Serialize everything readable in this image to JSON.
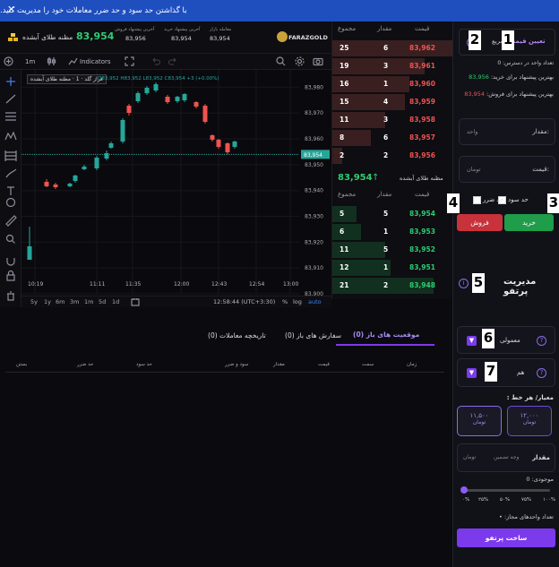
{
  "banner": {
    "text": "با گذاشتن حد سود و حد ضرر معاملات خود را مدیریت کنید.",
    "close": "✕"
  },
  "topbar": {
    "brand": "FARAZGOLD",
    "stat1_label": "معامله بازار",
    "stat1_value": "83,954",
    "stat2_label": "آخرین پیشنهاد خرید",
    "stat2_value": "83,954",
    "stat3_label": "آخرین پیشنهاد فروش",
    "stat3_value": "83,956",
    "price": "83,954",
    "instrument": "مظنه طلای آبشده"
  },
  "chart_toolbar": {
    "interval": "1m",
    "indicators": "Indicators"
  },
  "chart": {
    "legend_title": "فراز گلد · 1 · مظنه طلای آبشده",
    "ohlc": "O83,952 H83,952 L83,952 C83,954 +3 (+0.00%)",
    "price_ticks": [
      "83,980",
      "83,970",
      "83,960",
      "83,950",
      "83,940",
      "83,930",
      "83,920",
      "83,910",
      "83,900"
    ],
    "current_price": "83,954",
    "time_ticks": [
      "10:19",
      "11:11",
      "11:35",
      "12:00",
      "12:43",
      "12:54",
      "13:00"
    ],
    "ranges": [
      "5y",
      "1y",
      "6m",
      "3m",
      "1m",
      "5d",
      "1d"
    ],
    "clock": "12:58:44 (UTC+3:30)",
    "scale_opts": [
      "%",
      "log",
      "auto"
    ]
  },
  "orderbook": {
    "headers": [
      "قیمت",
      "مقدار",
      "مجموع"
    ],
    "asks": [
      {
        "price": "83,962",
        "qty": "6",
        "total": "25"
      },
      {
        "price": "83,961",
        "qty": "3",
        "total": "19"
      },
      {
        "price": "83,960",
        "qty": "1",
        "total": "16"
      },
      {
        "price": "83,959",
        "qty": "4",
        "total": "15"
      },
      {
        "price": "83,958",
        "qty": "3",
        "total": "11"
      },
      {
        "price": "83,957",
        "qty": "6",
        "total": "8"
      },
      {
        "price": "83,956",
        "qty": "2",
        "total": "2"
      }
    ],
    "mid_label": "مظنه طلای آبشده",
    "mid_price": "83,954",
    "bids": [
      {
        "price": "83,954",
        "qty": "5",
        "total": "5"
      },
      {
        "price": "83,953",
        "qty": "1",
        "total": "6"
      },
      {
        "price": "83,952",
        "qty": "5",
        "total": "11"
      },
      {
        "price": "83,951",
        "qty": "1",
        "total": "12"
      },
      {
        "price": "83,948",
        "qty": "2",
        "total": "21"
      }
    ]
  },
  "side": {
    "tab_set_price": "تعیین قیمت",
    "tab_fast": "سریع",
    "units_note": "تعداد واحد در دسترس: 0",
    "best_buy_label": "بهترین پیشنهاد برای خرید:",
    "best_buy_value": "83,956",
    "best_sell_label": "بهترین پیشنهاد برای فروش:",
    "best_sell_value": "83,954",
    "qty_label": "مقدار:",
    "qty_unit": "واحد",
    "price_label": "قیمت:",
    "price_unit": "تومان",
    "take_profit": "حد سود",
    "stop_loss": "حد ضرر",
    "buy": "خرید",
    "sell": "فروش",
    "portfolio_title": "مدیریت پرتفو",
    "mode_label": "معمولی",
    "hedge_label": "هم",
    "criteria_label": "معیار/ هر خط :",
    "opt1_value": "۱۲,۰۰۰",
    "opt1_unit": "تومان",
    "opt2_value": "۱۱,۵۰۰",
    "opt2_unit": "تومان",
    "amount_label": "مقدار",
    "amount_placeholder": "وجه تضمین",
    "amount_unit": "تومان",
    "balance": "موجودی: 0",
    "percent_ticks": [
      "۱۰۰%",
      "۷۵%",
      "۵۰%",
      "۲۵%",
      "۰%"
    ],
    "allowed_units": "تعداد واحدهای مجاز: •",
    "build_button": "ساخت پرتفو"
  },
  "bottom": {
    "tabs": [
      "موقعیت های باز (0)",
      "سفارش های باز (0)",
      "تاریخچه معاملات (0)"
    ],
    "columns": [
      "زمان",
      "سمت",
      "قیمت",
      "مقدار",
      "سود و ضرر",
      "حد سود",
      "حد ضرر",
      "بستن"
    ]
  },
  "badges": [
    "1",
    "2",
    "3",
    "4",
    "5",
    "6",
    "7"
  ],
  "colors": {
    "up": "#26a69a",
    "down": "#ef5350",
    "accent": "#8b5cf6",
    "buy": "#1f9d4a",
    "sell": "#c8323b",
    "banner": "#1f4fbf"
  },
  "chart_data": {
    "type": "candlestick",
    "x": [
      "10:19",
      "11:11",
      "11:35",
      "12:00",
      "12:43",
      "12:54",
      "13:00"
    ],
    "ylim": [
      83900,
      83985
    ],
    "current": 83954
  }
}
